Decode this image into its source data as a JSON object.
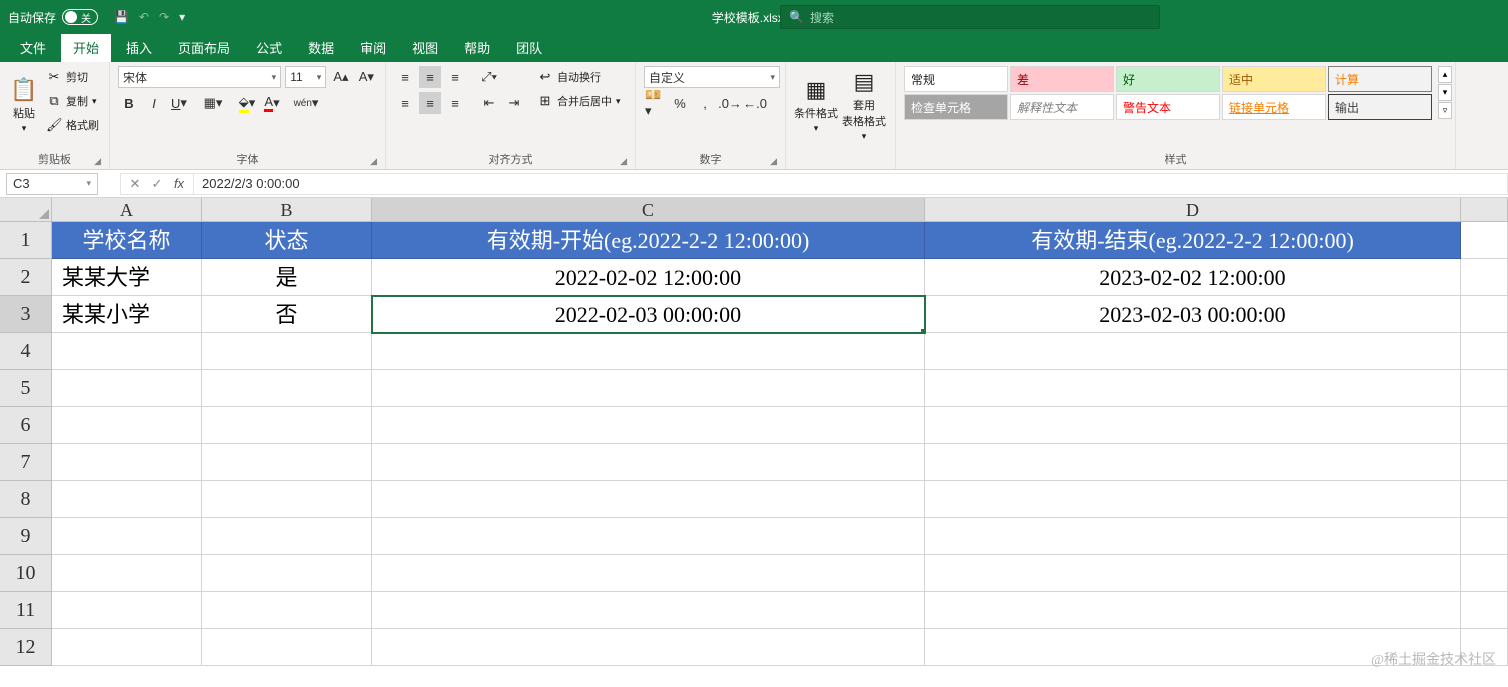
{
  "title": {
    "autosave": "自动保存",
    "autosave_state": "关",
    "filename": "学校模板.xlsx",
    "search_placeholder": "搜索"
  },
  "tabs": {
    "file": "文件",
    "home": "开始",
    "insert": "插入",
    "layout": "页面布局",
    "formula": "公式",
    "data": "数据",
    "review": "审阅",
    "view": "视图",
    "help": "帮助",
    "team": "团队"
  },
  "ribbon": {
    "clipboard": {
      "paste": "粘贴",
      "cut": "剪切",
      "copy": "复制",
      "brush": "格式刷",
      "label": "剪贴板"
    },
    "font": {
      "name": "宋体",
      "size": "11",
      "label": "字体"
    },
    "align": {
      "wrap": "自动换行",
      "merge": "合并后居中",
      "label": "对齐方式"
    },
    "number": {
      "format": "自定义",
      "label": "数字"
    },
    "cond": {
      "cond": "条件格式",
      "table": "套用\n表格格式"
    },
    "styles": {
      "label": "样式",
      "normal": "常规",
      "bad": "差",
      "good": "好",
      "neutral": "适中",
      "calc": "计算",
      "check": "检查单元格",
      "explain": "解释性文本",
      "warn": "警告文本",
      "link": "链接单元格",
      "output": "输出"
    }
  },
  "formula_bar": {
    "cell_ref": "C3",
    "value": "2022/2/3  0:00:00"
  },
  "columns": [
    "A",
    "B",
    "C",
    "D"
  ],
  "rows": [
    "1",
    "2",
    "3",
    "4",
    "5",
    "6",
    "7",
    "8",
    "9",
    "10",
    "11",
    "12"
  ],
  "header_row": {
    "A": "学校名称",
    "B": "状态",
    "C": "有效期-开始(eg.2022-2-2 12:00:00)",
    "D": "有效期-结束(eg.2022-2-2 12:00:00)"
  },
  "data_rows": [
    {
      "A": "某某大学",
      "B": "是",
      "C": "2022-02-02 12:00:00",
      "D": "2023-02-02 12:00:00"
    },
    {
      "A": "某某小学",
      "B": "否",
      "C": "2022-02-03 00:00:00",
      "D": "2023-02-03 00:00:00"
    }
  ],
  "watermark": "@稀土掘金技术社区"
}
